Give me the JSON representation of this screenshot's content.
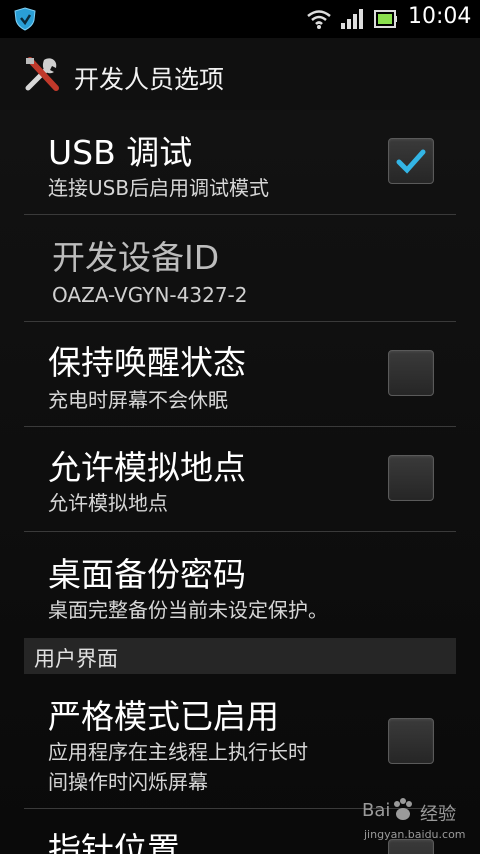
{
  "status_bar": {
    "time": "10:04"
  },
  "title_bar": {
    "title": "开发人员选项"
  },
  "settings": [
    {
      "title": "USB 调试",
      "summary": "连接USB后启用调试模式",
      "checked": true
    },
    {
      "title": "开发设备ID",
      "summary": "OAZA-VGYN-4327-2"
    },
    {
      "title": "保持唤醒状态",
      "summary": "充电时屏幕不会休眠",
      "checked": false
    },
    {
      "title": "允许模拟地点",
      "summary": "允许模拟地点",
      "checked": false
    },
    {
      "title": "桌面备份密码",
      "summary": "桌面完整备份当前未设定保护。"
    }
  ],
  "section_ui": {
    "header": "用户界面",
    "items": [
      {
        "title": "严格模式已启用",
        "summary_line1": "应用程序在主线程上执行长时",
        "summary_line2": "间操作时闪烁屏幕",
        "checked": false
      },
      {
        "title": "指针位置"
      }
    ]
  },
  "watermark": {
    "brand": "Bai",
    "suffix": "经验",
    "url": "jingyan.baidu.com"
  },
  "colors": {
    "checkmark": "#33b5e5",
    "background": "#0d0d0d"
  }
}
